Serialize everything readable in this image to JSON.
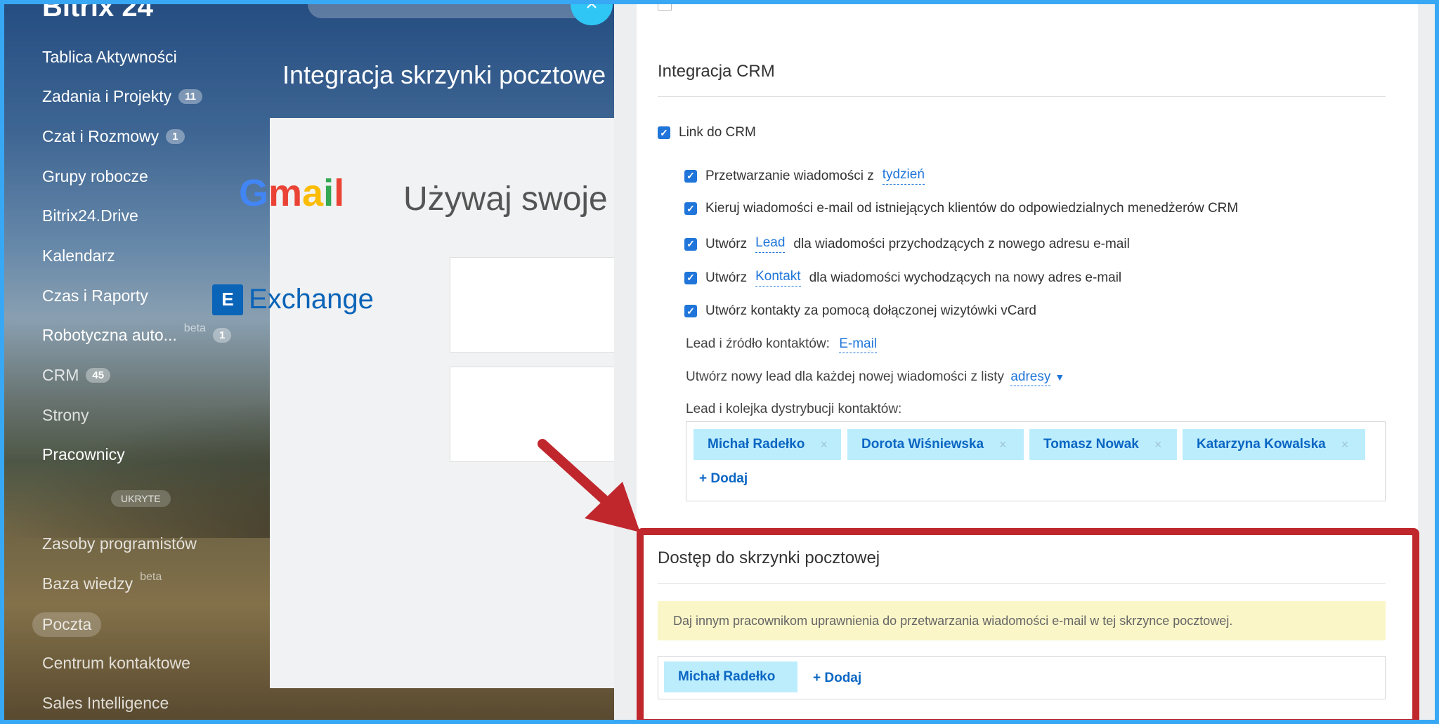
{
  "sidebar": {
    "logo": "Bitrix 24",
    "items": [
      {
        "label": "Tablica Aktywności"
      },
      {
        "label": "Zadania i Projekty",
        "count": "11"
      },
      {
        "label": "Czat i Rozmowy",
        "count": "1"
      },
      {
        "label": "Grupy robocze"
      },
      {
        "label": "Bitrix24.Drive"
      },
      {
        "label": "Kalendarz"
      },
      {
        "label": "Czas i Raporty"
      },
      {
        "label": "Robotyczna auto...",
        "badge": "beta",
        "count": "1"
      },
      {
        "label": "CRM",
        "count": "45"
      },
      {
        "label": "Strony"
      },
      {
        "label": "Pracownicy"
      },
      {
        "label": "Zasoby programistów"
      },
      {
        "label": "Baza wiedzy",
        "badge": "beta"
      },
      {
        "label": "Poczta"
      },
      {
        "label": "Centrum kontaktowe"
      },
      {
        "label": "Sales Intelligence"
      }
    ],
    "hidden_label": "UKRYTE"
  },
  "main": {
    "title": "Integracja skrzynki pocztowe",
    "card_title": "Używaj swoje",
    "gmail": "Gmail",
    "exchange_icon": "E",
    "exchange": "Exchange"
  },
  "close_icon": "×",
  "crm": {
    "title": "Integracja CRM",
    "link_label": "Link do CRM",
    "process_prefix": "Przetwarzanie wiadomości z",
    "process_link": "tydzień",
    "route": "Kieruj wiadomości e-mail od istniejących klientów do odpowiedzialnych menedżerów CRM",
    "create_word": "Utwórz",
    "lead_link": "Lead",
    "lead_suffix": "dla wiadomości przychodzących z nowego adresu e-mail",
    "contact_link": "Kontakt",
    "contact_suffix": "dla wiadomości wychodzących na nowy adres e-mail",
    "vcard": "Utwórz kontakty za pomocą dołączonej wizytówki vCard",
    "source_label": "Lead i źródło kontaktów:",
    "source_value": "E-mail",
    "newlead_label": "Utwórz nowy lead dla każdej nowej wiadomości z listy",
    "newlead_value": "adresy",
    "queue_label": "Lead i kolejka dystrybucji kontaktów:",
    "queue": [
      "Michał Radełko",
      "Dorota Wiśniewska",
      "Tomasz Nowak",
      "Katarzyna Kowalska"
    ],
    "remove_glyph": "×",
    "add": "+ Dodaj"
  },
  "access": {
    "title": "Dostęp do skrzynki pocztowej",
    "note": "Daj innym pracownikom uprawnienia do przetwarzania wiadomości e-mail w tej skrzynce pocztowej.",
    "user": "Michał Radełko",
    "add": "+ Dodaj"
  },
  "colors": {
    "frame": "#38a8f5",
    "accent": "#1f75d9",
    "chip_bg": "#bcedfc",
    "highlight": "#c0272d",
    "note_bg": "#fbf6c8"
  }
}
